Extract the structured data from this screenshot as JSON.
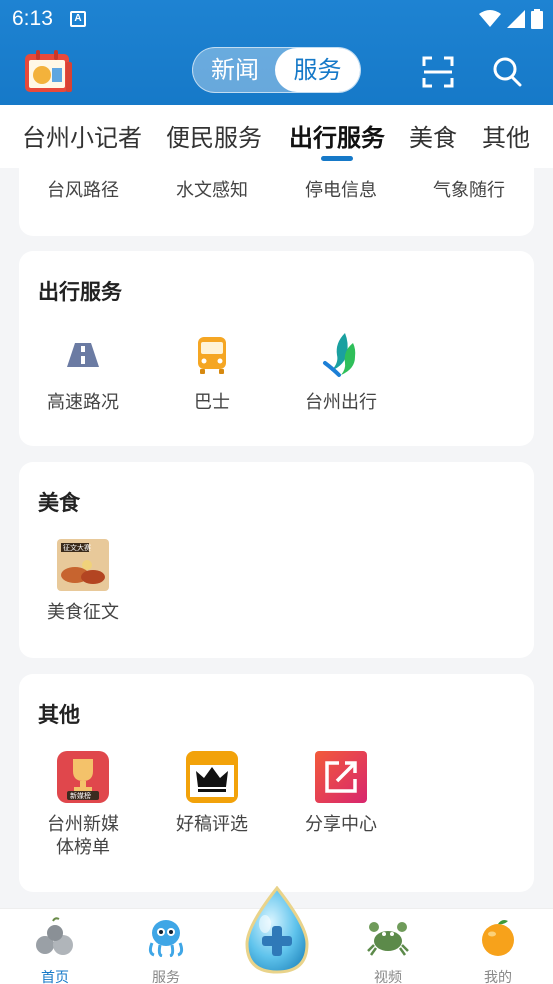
{
  "status": {
    "time": "6:13",
    "notif_glyph": "A"
  },
  "header": {
    "segment": {
      "news": "新闻",
      "service": "服务",
      "selected": "服务"
    },
    "icons": [
      "app-logo-icon",
      "scan-icon",
      "search-icon"
    ]
  },
  "tabs": [
    {
      "label": "台州小记者"
    },
    {
      "label": "便民服务"
    },
    {
      "label": "出行服务",
      "active": true
    },
    {
      "label": "美食"
    },
    {
      "label": "其他"
    }
  ],
  "partial_card": {
    "items": [
      "台风路径",
      "水文感知",
      "停电信息",
      "气象随行"
    ]
  },
  "sections": {
    "travel": {
      "title": "出行服务",
      "items": [
        {
          "label": "高速路况",
          "icon": "highway-icon"
        },
        {
          "label": "巴士",
          "icon": "bus-icon"
        },
        {
          "label": "台州出行",
          "icon": "taizhou-travel-icon"
        }
      ]
    },
    "food": {
      "title": "美食",
      "items": [
        {
          "label": "美食征文",
          "icon": "food-essay-icon",
          "badge": "征文大赛"
        }
      ]
    },
    "other": {
      "title": "其他",
      "items": [
        {
          "label": "台州新媒体榜单",
          "line1": "台州新媒",
          "line2": "体榜单",
          "icon": "trophy-icon",
          "badge": "新媒榜"
        },
        {
          "label": "好稿评选",
          "icon": "crown-icon"
        },
        {
          "label": "分享中心",
          "icon": "share-icon"
        }
      ]
    }
  },
  "bottom_nav": [
    {
      "label": "首页",
      "icon": "home-icon",
      "active": true
    },
    {
      "label": "服务",
      "icon": "service-icon"
    },
    {
      "label": "",
      "icon": "add-drop-icon"
    },
    {
      "label": "视频",
      "icon": "video-crab-icon"
    },
    {
      "label": "我的",
      "icon": "orange-profile-icon"
    }
  ],
  "colors": {
    "primary": "#1679c8",
    "header_bg": "#1e83d2",
    "page_bg": "#f4f5f7"
  }
}
